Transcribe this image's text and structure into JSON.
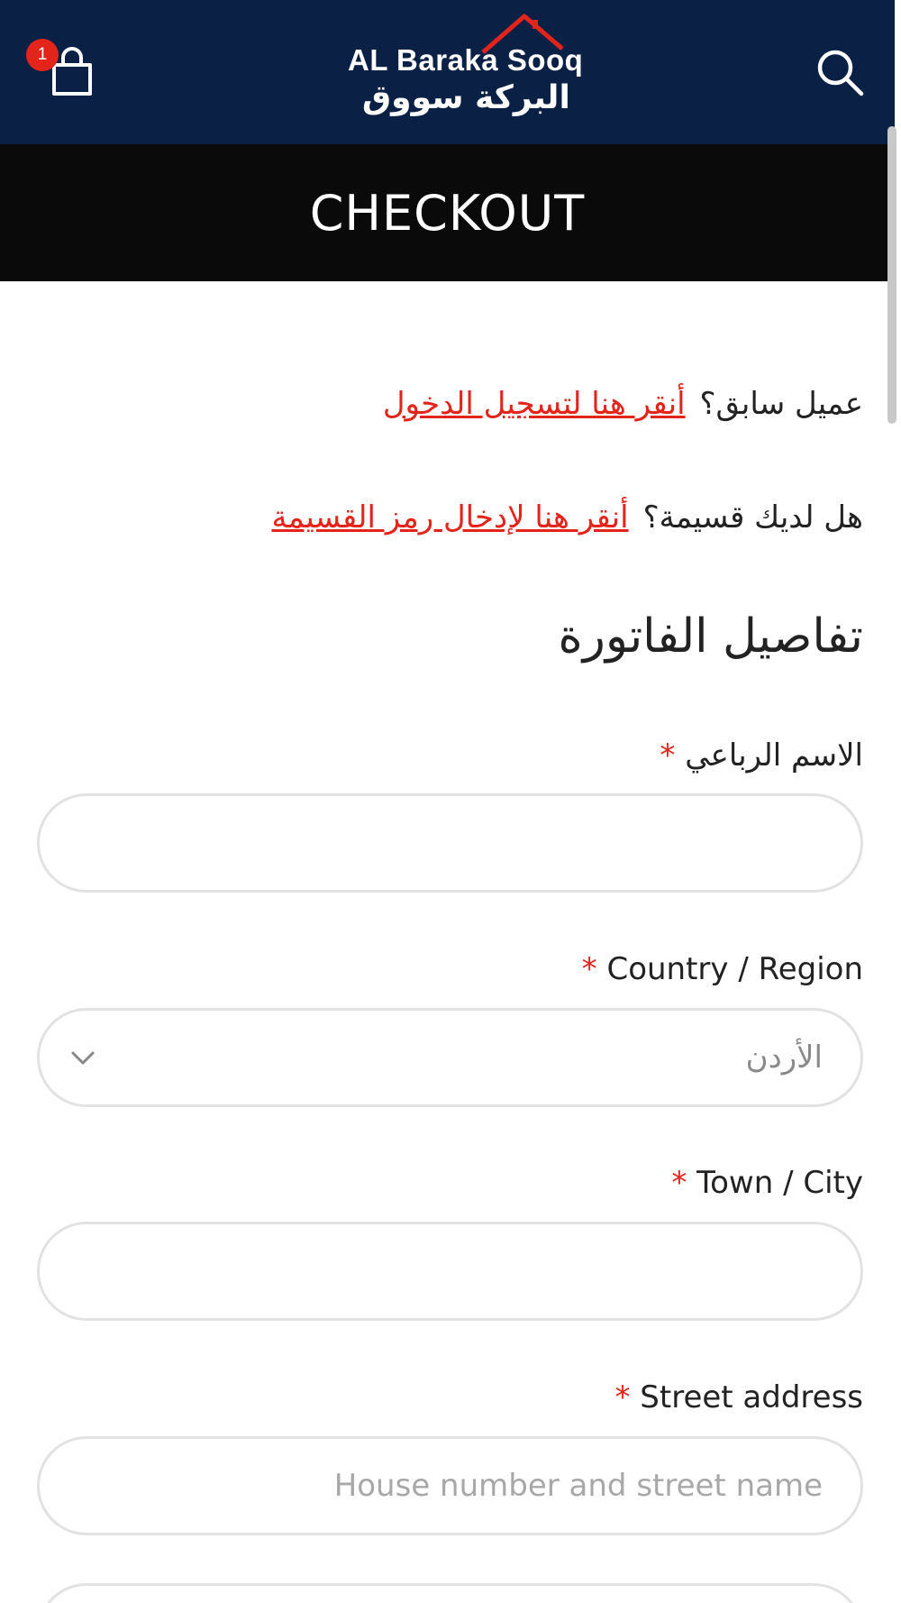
{
  "header": {
    "cart_count": "1",
    "logo_en": "AL Baraka Sooq",
    "logo_ar": "البركة سووق",
    "brand_color": "#0b2045",
    "accent_color": "#e3241b",
    "icons": {
      "cart": "shopping-bag-icon",
      "search": "search-icon"
    }
  },
  "page": {
    "title": "CHECKOUT"
  },
  "notices": {
    "returning_prefix": "عميل سابق؟",
    "returning_link": "أنقر هنا لتسجيل الدخول",
    "coupon_prefix": "هل لديك قسيمة؟",
    "coupon_link": "أنقر هنا لإدخال رمز القسيمة"
  },
  "billing": {
    "title": "تفاصيل الفاتورة",
    "required_mark": "*",
    "full_name": {
      "label": "الاسم الرباعي",
      "value": ""
    },
    "country": {
      "label": "Country / Region",
      "value": "الأردن"
    },
    "city": {
      "label": "Town / City",
      "value": ""
    },
    "street": {
      "label": "Street address",
      "placeholder": "House number and street name"
    }
  }
}
